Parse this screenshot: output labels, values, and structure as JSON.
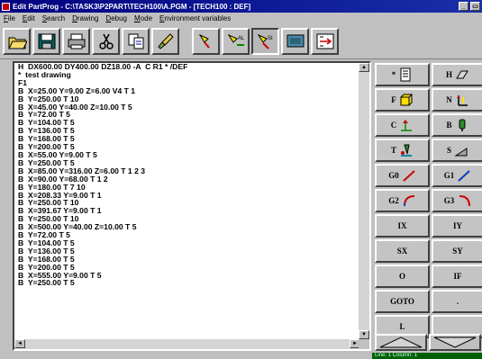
{
  "window": {
    "title": "Edit PartProg - C:\\TASK3\\P2PART\\TECH100\\A.PGM - [TECH100 : DEF]",
    "minimize_label": "_",
    "maximize_label": "▭"
  },
  "menu": [
    "File",
    "Edit",
    "Search",
    "Drawing",
    "Debug",
    "Mode",
    "Environment variables"
  ],
  "toolbar": {
    "buttons": [
      "open-folder",
      "save",
      "print",
      "cut",
      "copy",
      "paste",
      "highlight",
      "highlight-all",
      "highlight-select",
      "screen",
      "rule-insert"
    ]
  },
  "editor": {
    "lines": [
      "H  DX600.00 DY400.00 DZ18.00 -A  C R1 * /DEF",
      "*  test drawing",
      "F1",
      "B  X=25.00 Y=9.00 Z=6.00 V4 T 1",
      "B  Y=250.00 T 10",
      "B  X=45.00 Y=40.00 Z=10.00 T 5",
      "B  Y=72.00 T 5",
      "B  Y=104.00 T 5",
      "B  Y=136.00 T 5",
      "B  Y=168.00 T 5",
      "B  Y=200.00 T 5",
      "B  X=55.00 Y=9.00 T 5",
      "B  Y=250.00 T 5",
      "B  X=85.00 Y=316.00 Z=6.00 T 1 2 3",
      "B  X=90.00 Y=68.00 T 1 2",
      "B  Y=180.00 T 7 10",
      "B  X=208.33 Y=9.00 T 1",
      "B  Y=250.00 T 10",
      "B  X=391.67 Y=9.00 T 1",
      "B  Y=250.00 T 10",
      "B  X=500.00 Y=40.00 Z=10.00 T 5",
      "B  Y=72.00 T 5",
      "B  Y=104.00 T 5",
      "B  Y=136.00 T 5",
      "B  Y=168.00 T 5",
      "B  Y=200.00 T 5",
      "B  X=555.00 Y=9.00 T 5",
      "B  Y=250.00 T 5"
    ],
    "scroll_up": "▲",
    "scroll_down": "▼"
  },
  "panel": {
    "buttons": [
      {
        "label": "*",
        "icon": "document-icon"
      },
      {
        "label": "H",
        "icon": "header-icon"
      },
      {
        "label": "F",
        "icon": "cube-icon"
      },
      {
        "label": "N",
        "icon": "axes-icon"
      },
      {
        "label": "C",
        "icon": "axis-arrow-icon"
      },
      {
        "label": "B",
        "icon": "drill-icon"
      },
      {
        "label": "T",
        "icon": "tool-icon"
      },
      {
        "label": "S",
        "icon": "saw-icon"
      },
      {
        "label": "G0",
        "icon": "line-icon"
      },
      {
        "label": "G1",
        "icon": "line-icon"
      },
      {
        "label": "G2",
        "icon": "arc-icon"
      },
      {
        "label": "G3",
        "icon": "arc-icon"
      },
      {
        "label": "IX",
        "icon": ""
      },
      {
        "label": "IY",
        "icon": ""
      },
      {
        "label": "SX",
        "icon": ""
      },
      {
        "label": "SY",
        "icon": ""
      },
      {
        "label": "O",
        "icon": ""
      },
      {
        "label": "IF",
        "icon": ""
      },
      {
        "label": "GOTO",
        "icon": ""
      },
      {
        "label": ".",
        "icon": ""
      },
      {
        "label": "L",
        "icon": ""
      },
      {
        "label": "",
        "icon": ""
      }
    ],
    "nav": [
      "up-arrow",
      "down-arrow"
    ]
  },
  "status": {
    "text": "Line: 1 Column: 1"
  },
  "colors": {
    "title_bar": "#000080",
    "status_green": "#006000",
    "accent_yellow": "#ffe000"
  }
}
